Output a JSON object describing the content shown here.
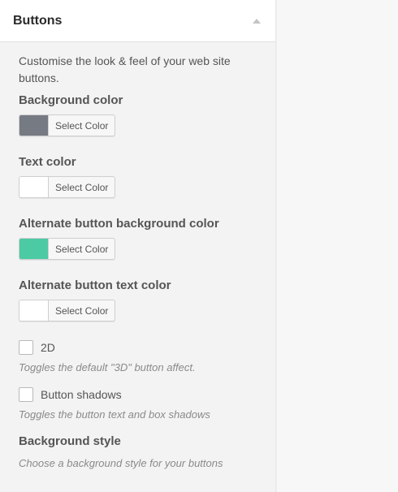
{
  "section": {
    "title": "Buttons",
    "collapse_icon": "chevron-up-icon"
  },
  "intro": "Customise the look & feel of your web site buttons.",
  "settings": [
    {
      "label": "Background color",
      "picker_label": "Select Color",
      "swatch_color": "#767a82"
    },
    {
      "label": "Text color",
      "picker_label": "Select Color",
      "swatch_color": "#ffffff"
    },
    {
      "label": "Alternate button background color",
      "picker_label": "Select Color",
      "swatch_color": "#4ccaa4"
    },
    {
      "label": "Alternate button text color",
      "picker_label": "Select Color",
      "swatch_color": "#ffffff"
    }
  ],
  "checks": [
    {
      "label": "2D",
      "checked": false,
      "description": "Toggles the default \"3D\" button affect."
    },
    {
      "label": "Button shadows",
      "checked": false,
      "description": "Toggles the button text and box shadows"
    }
  ],
  "background_style": {
    "label": "Background style",
    "description": "Choose a background style for your buttons"
  }
}
